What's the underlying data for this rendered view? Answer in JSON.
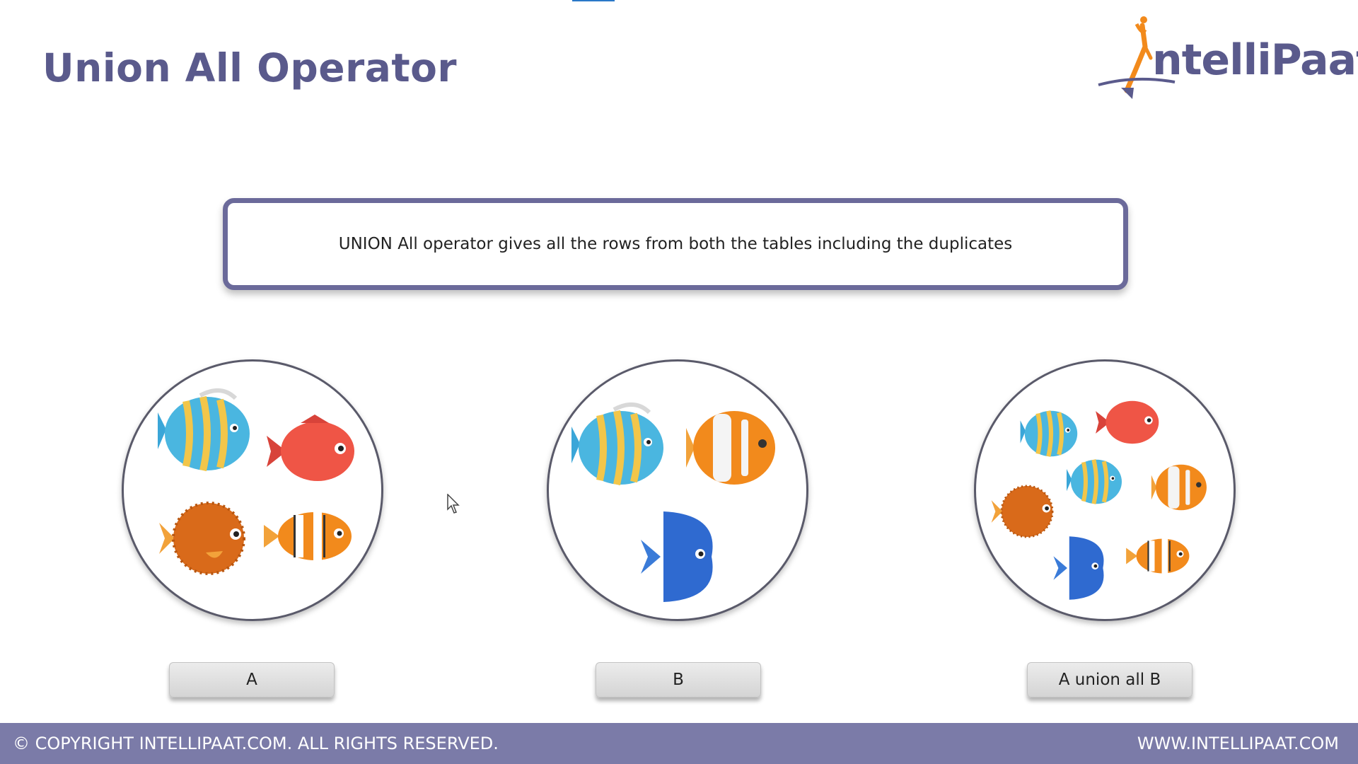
{
  "slide": {
    "title": "Union All Operator",
    "definition": "UNION All operator gives all the rows from both the tables including the duplicates"
  },
  "logo": {
    "text": "ntelliPaat",
    "colors": {
      "primary": "#5a5a8c",
      "accent": "#f28a1c"
    }
  },
  "sets": [
    {
      "label": "A",
      "fish": [
        "striped-blue-fish",
        "red-fish",
        "orange-puffer-fish",
        "clownfish"
      ]
    },
    {
      "label": "B",
      "fish": [
        "striped-blue-fish",
        "orange-white-fish",
        "blue-tang-fish"
      ]
    },
    {
      "label": "A union all B",
      "fish": [
        "striped-blue-fish",
        "red-fish",
        "striped-blue-fish",
        "orange-white-fish",
        "orange-puffer-fish",
        "blue-tang-fish",
        "clownfish"
      ]
    }
  ],
  "footer": {
    "copyright": "© COPYRIGHT  INTELLIPAAT.COM. ALL RIGHTS RESERVED.",
    "website": "WWW.INTELLIPAAT.COM"
  },
  "colors": {
    "header": "#5a5a8c",
    "footer_bg": "#7b7ba8",
    "box_border": "#6b6a9a"
  }
}
